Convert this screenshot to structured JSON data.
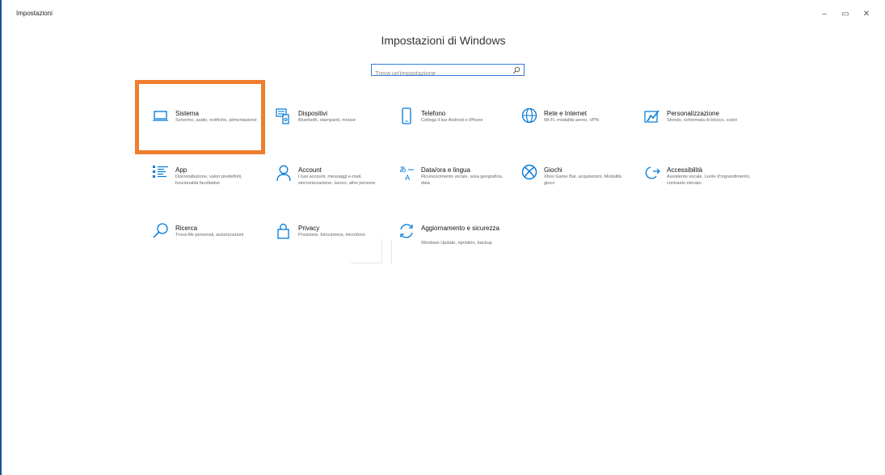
{
  "window": {
    "app_title": "Impostazioni",
    "controls": {
      "minimize": "–",
      "maximize": "▭",
      "close": "✕"
    }
  },
  "heading": "Impostazioni di Windows",
  "search": {
    "placeholder": "Trova un'impostazione"
  },
  "accent_color": "#0078d7",
  "highlight_color": "#ee7f2d",
  "tiles": [
    {
      "icon": "laptop-icon",
      "title": "Sistema",
      "desc": "Schermo, audio, notifiche, alimentazione"
    },
    {
      "icon": "devices-icon",
      "title": "Dispositivi",
      "desc": "Bluetooth, stampanti, mouse"
    },
    {
      "icon": "phone-icon",
      "title": "Telefono",
      "desc": "Collega il tuo Android o iPhone"
    },
    {
      "icon": "globe-icon",
      "title": "Rete e Internet",
      "desc": "Wi-Fi, modalità aereo, VPN"
    },
    {
      "icon": "personalization-icon",
      "title": "Personalizzazione",
      "desc": "Sfondo, schermata di blocco, colori"
    },
    {
      "icon": "apps-icon",
      "title": "App",
      "desc": "Disinstallazione, valori predefiniti, funzionalità facoltative"
    },
    {
      "icon": "account-icon",
      "title": "Account",
      "desc": "I tuoi account, messaggi e-mail, sincronizzazione, lavoro, altre persone"
    },
    {
      "icon": "time-language-icon",
      "title": "Data/ora e lingua",
      "desc": "Riconoscimento vocale, area geografica, data"
    },
    {
      "icon": "xbox-icon",
      "title": "Giochi",
      "desc": "Xbox Game Bar, acquisizioni, Modalità gioco"
    },
    {
      "icon": "accessibility-icon",
      "title": "Accessibilità",
      "desc": "Assistente vocale, Lente d'ingrandimento, contrasto elevato"
    },
    {
      "icon": "search-icon",
      "title": "Ricerca",
      "desc": "Trova file personali, autorizzazioni"
    },
    {
      "icon": "lock-icon",
      "title": "Privacy",
      "desc": "Posizione, fotocamera, microfono"
    },
    {
      "icon": "update-icon",
      "title": "Aggiornamento e sicurezza",
      "desc": "Windows Update, ripristino, backup"
    }
  ]
}
